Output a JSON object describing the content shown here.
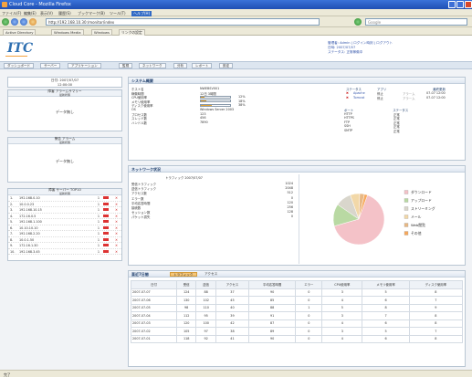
{
  "window": {
    "title": "Cloud Core - Mozilla Firefox"
  },
  "menu": [
    "ファイル(F)",
    "編集(E)",
    "表示(V)",
    "履歴(S)",
    "ブックマーク(B)",
    "ツール(T)",
    "ヘルプ(H)"
  ],
  "menu_selected": "ヘルプ(H)",
  "nav": {
    "url": "http://192.168.10.30:/monitor/index",
    "search_placeholder": "Google"
  },
  "bookmarks": [
    "Active Directory",
    "Windows Media",
    "Windows",
    "リンクの設定"
  ],
  "header": {
    "logo": "ITC",
    "links": [
      "管理者: Admin | ログイン時刻 | ログアウト",
      "日時: 2007/07/07",
      "ステータス: 正常稼働中"
    ]
  },
  "tabs": [
    "ダッシュボード",
    "サーバー",
    "アプリケーション",
    "監視",
    "ネットワーク",
    "分析",
    "レポート",
    "設定"
  ],
  "left": {
    "date_box": {
      "line1": "日付: 2007/07/07",
      "line2": "12:00:00"
    },
    "box1": {
      "title": "障害 アラームサマリー",
      "badge": "最新状態",
      "value": "データ無し"
    },
    "box2": {
      "title": "警告 アラーム",
      "badge": "最新状態",
      "value": "データ無し"
    },
    "server_list": {
      "title": "障害 サーバー TOP10",
      "badge": "最新状態",
      "rows": [
        {
          "no": "1.",
          "ip": "192.168.0.10",
          "n": "1"
        },
        {
          "no": "2.",
          "ip": "10.0.0.23",
          "n": "1"
        },
        {
          "no": "3.",
          "ip": "192.168.10.15",
          "n": "1"
        },
        {
          "no": "4.",
          "ip": "172.16.0.5",
          "n": "1"
        },
        {
          "no": "5.",
          "ip": "192.168.1.100",
          "n": "1"
        },
        {
          "no": "6.",
          "ip": "10.10.10.10",
          "n": "1"
        },
        {
          "no": "7.",
          "ip": "192.168.2.20",
          "n": "1"
        },
        {
          "no": "8.",
          "ip": "10.0.1.50",
          "n": "1"
        },
        {
          "no": "9.",
          "ip": "172.16.1.30",
          "n": "1"
        },
        {
          "no": "10.",
          "ip": "192.168.3.45",
          "n": "1"
        }
      ]
    }
  },
  "system": {
    "title": "システム概要",
    "rows": [
      {
        "k": "ホスト名",
        "v": "NWEBSV001"
      },
      {
        "k": "稼働時間",
        "v": "12日 3時間"
      },
      {
        "k": "CPU使用率",
        "v": "12%",
        "pct": 12
      },
      {
        "k": "メモリ使用率",
        "v": "18%",
        "pct": 18
      },
      {
        "k": "ディスク使用率",
        "v": "38%",
        "pct": 38
      },
      {
        "k": "OS",
        "v": "Windows Server 2003"
      },
      {
        "k": "プロセス数",
        "v": "123"
      },
      {
        "k": "スレッド数",
        "v": "456"
      },
      {
        "k": "ハンドル数",
        "v": "7890"
      }
    ],
    "alerts_head": [
      "ステータス",
      "アプリ",
      "ステータス",
      "最終更新"
    ],
    "alerts": [
      {
        "icon": "error",
        "name": "Apache",
        "s1": "停止",
        "s2": "アラーム",
        "time": "07-07 12:00"
      },
      {
        "icon": "error",
        "name": "Tomcat",
        "s1": "停止",
        "s2": "アラーム",
        "time": "07-07 12:00"
      }
    ],
    "ports_head": [
      "ポート",
      "ステータス"
    ],
    "ports": [
      {
        "k": "HTTP",
        "v": "正常"
      },
      {
        "k": "HTTPS",
        "v": "正常"
      },
      {
        "k": "FTP",
        "v": "正常"
      },
      {
        "k": "SSH",
        "v": "正常"
      },
      {
        "k": "SMTP",
        "v": "正常"
      }
    ]
  },
  "traffic": {
    "title": "ネットワーク状況",
    "subtitle": "トラフィック 2007/07/07",
    "rows": [
      {
        "k": "受信トラフィック",
        "v": "1024"
      },
      {
        "k": "送信トラフィック",
        "v": "2048"
      },
      {
        "k": "アクセス数",
        "v": "512"
      },
      {
        "k": "エラー数",
        "v": "0"
      },
      {
        "k": "平均応答時間",
        "v": "120"
      },
      {
        "k": "接続数",
        "v": "256"
      },
      {
        "k": "セッション数",
        "v": "128"
      },
      {
        "k": "パケット損失",
        "v": "0"
      }
    ]
  },
  "chart_data": {
    "type": "pie",
    "title": "",
    "series": [
      {
        "label": "ダウンロード",
        "value": 65,
        "color": "#f4c2c8"
      },
      {
        "label": "アップロード",
        "value": 14,
        "color": "#b9d9a3"
      },
      {
        "label": "ストリーミング",
        "value": 10,
        "color": "#d9d6cc"
      },
      {
        "label": "メール",
        "value": 6,
        "color": "#f2d8a8"
      },
      {
        "label": "Web閲覧",
        "value": 3,
        "color": "#e8b884"
      },
      {
        "label": "その他",
        "value": 2,
        "color": "#f7a85b"
      }
    ]
  },
  "report": {
    "title": "直近7日間",
    "subtabs": [
      "トラフィック",
      "アクセス"
    ],
    "columns": [
      "日付",
      "受信",
      "送信",
      "アクセス",
      "平均応答時間",
      "エラー",
      "CPU使用率",
      "メモリ使用率",
      "ディスク使用率"
    ],
    "rows": [
      [
        "2007-07-07",
        "124",
        "88",
        "37",
        "90",
        "0",
        "3",
        "5",
        "8"
      ],
      [
        "2007-07-06",
        "130",
        "102",
        "45",
        "85",
        "0",
        "4",
        "6",
        "7"
      ],
      [
        "2007-07-05",
        "98",
        "110",
        "40",
        "88",
        "1",
        "5",
        "8",
        "9"
      ],
      [
        "2007-07-04",
        "112",
        "95",
        "39",
        "91",
        "0",
        "3",
        "7",
        "8"
      ],
      [
        "2007-07-03",
        "120",
        "100",
        "42",
        "87",
        "0",
        "4",
        "6",
        "8"
      ],
      [
        "2007-07-02",
        "105",
        "97",
        "38",
        "89",
        "0",
        "3",
        "5",
        "7"
      ],
      [
        "2007-07-01",
        "118",
        "92",
        "41",
        "90",
        "0",
        "4",
        "6",
        "8"
      ]
    ]
  },
  "status_text": "完了"
}
